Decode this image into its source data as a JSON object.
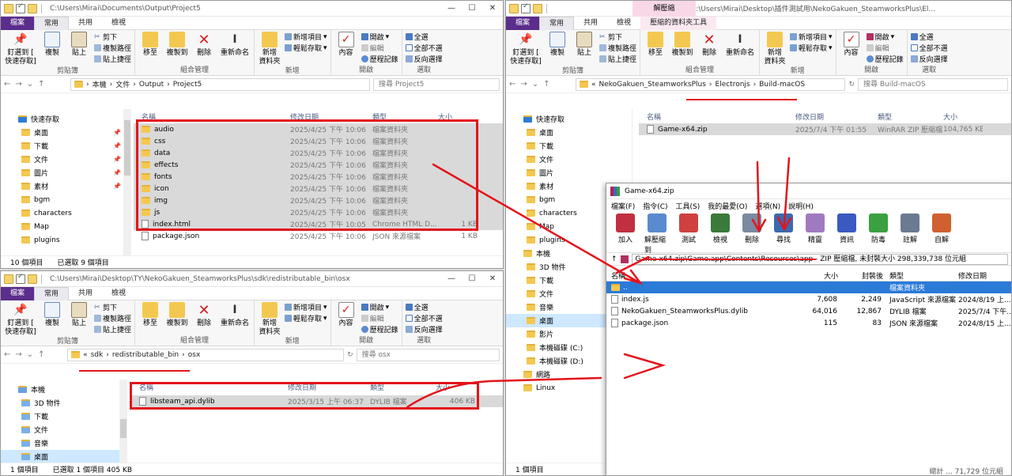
{
  "ribbon_labels": {
    "file": "檔案",
    "home": "常用",
    "share": "共用",
    "view": "檢視",
    "pin": "釘選到 [\n快速存取]",
    "copy": "複製",
    "paste": "貼上",
    "cut": "剪下",
    "copy_path": "複製路徑",
    "paste_shortcut": "貼上捷徑",
    "move_to": "移至",
    "copy_to": "複製到",
    "delete": "刪除",
    "rename": "重新命名",
    "new_folder": "新增\n資料夾",
    "new_item": "新增項目",
    "easy_access": "輕鬆存取",
    "properties": "內容",
    "open": "開啟",
    "edit": "編輯",
    "history": "歷程記錄",
    "select_all": "全選",
    "select_none": "全部不選",
    "invert": "反向選擇",
    "g_clipboard": "剪貼簿",
    "g_organize": "組合管理",
    "g_new": "新增",
    "g_open": "開啟",
    "g_select": "選取",
    "manage_tab": "解壓縮",
    "compressed_tools": "壓縮的資料夾工具"
  },
  "col_headers": {
    "name": "名稱",
    "modified": "修改日期",
    "type": "類型",
    "size": "大小"
  },
  "win1": {
    "title": "C:\\Users\\Mirai\\Documents\\Output\\Project5",
    "path": [
      "本機",
      "文件",
      "Output",
      "Project5"
    ],
    "search": "搜尋 Project5",
    "nav": [
      {
        "label": "快速存取",
        "pinned": false
      },
      {
        "label": "桌面",
        "pinned": true
      },
      {
        "label": "下載",
        "pinned": true
      },
      {
        "label": "文件",
        "pinned": true
      },
      {
        "label": "圖片",
        "pinned": true
      },
      {
        "label": "素材",
        "pinned": true
      },
      {
        "label": "bgm",
        "pinned": false
      },
      {
        "label": "characters",
        "pinned": false
      },
      {
        "label": "Map",
        "pinned": false
      },
      {
        "label": "plugins",
        "pinned": false
      }
    ],
    "files": [
      {
        "name": "audio",
        "date": "2025/4/25 下午 10:06",
        "type": "檔案資料夾",
        "size": ""
      },
      {
        "name": "css",
        "date": "2025/4/25 下午 10:06",
        "type": "檔案資料夾",
        "size": ""
      },
      {
        "name": "data",
        "date": "2025/4/25 下午 10:06",
        "type": "檔案資料夾",
        "size": ""
      },
      {
        "name": "effects",
        "date": "2025/4/25 下午 10:06",
        "type": "檔案資料夾",
        "size": ""
      },
      {
        "name": "fonts",
        "date": "2025/4/25 下午 10:06",
        "type": "檔案資料夾",
        "size": ""
      },
      {
        "name": "icon",
        "date": "2025/4/25 下午 10:06",
        "type": "檔案資料夾",
        "size": ""
      },
      {
        "name": "img",
        "date": "2025/4/25 下午 10:06",
        "type": "檔案資料夾",
        "size": ""
      },
      {
        "name": "js",
        "date": "2025/4/25 下午 10:06",
        "type": "檔案資料夾",
        "size": ""
      },
      {
        "name": "index.html",
        "date": "2025/4/25 下午 10:05",
        "type": "Chrome HTML D...",
        "size": "1 KB"
      },
      {
        "name": "package.json",
        "date": "2025/4/25 下午 10:06",
        "type": "JSON 來源檔案",
        "size": "1 KB"
      }
    ],
    "status_count": "10 個項目",
    "status_sel": "已選取 9 個項目"
  },
  "win2": {
    "title": "C:\\Users\\Mirai\\Desktop\\TY\\NekoGakuen_SteamworksPlus\\sdk\\redistributable_bin\\osx",
    "path": [
      "«",
      "sdk",
      "redistributable_bin",
      "osx"
    ],
    "search": "搜尋 osx",
    "nav": [
      {
        "label": "本機"
      },
      {
        "label": "3D 物件"
      },
      {
        "label": "下載"
      },
      {
        "label": "文件"
      },
      {
        "label": "音樂"
      },
      {
        "label": "桌面"
      }
    ],
    "files": [
      {
        "name": "libsteam_api.dylib",
        "date": "2025/3/15 上午 06:37",
        "type": "DYLIB 檔案",
        "size": "406 KB"
      }
    ],
    "status_count": "1 個項目",
    "status_sel": "已選取 1 個項目  405 KB"
  },
  "win3": {
    "title": "C:\\Users\\Mirai\\Desktop\\插件測試用\\NekoGakuen_SteamworksPlus\\El...",
    "path": [
      "«",
      "NekoGakuen_SteamworksPlus",
      "Electronjs",
      "Build-macOS"
    ],
    "search": "搜尋 Build-macOS",
    "nav": [
      {
        "label": "快速存取"
      },
      {
        "label": "桌面"
      },
      {
        "label": "下載"
      },
      {
        "label": "文件"
      },
      {
        "label": "圖片"
      },
      {
        "label": "素材"
      },
      {
        "label": "bgm"
      },
      {
        "label": "characters"
      },
      {
        "label": "Map"
      },
      {
        "label": "plugins"
      },
      {
        "label": "本機"
      },
      {
        "label": "3D 物件"
      },
      {
        "label": "下載"
      },
      {
        "label": "文件"
      },
      {
        "label": "音樂"
      },
      {
        "label": "桌面"
      },
      {
        "label": "影片"
      },
      {
        "label": "本機磁碟 (C:)"
      },
      {
        "label": "本機磁碟 (D:)"
      },
      {
        "label": "網路"
      },
      {
        "label": "Linux"
      }
    ],
    "files": [
      {
        "name": "Game-x64.zip",
        "date": "2025/7/4 下午 01:55",
        "type": "WinRAR ZIP 壓縮檔",
        "size": "104,765 KB"
      }
    ],
    "status_count": "1 個項目"
  },
  "winrar": {
    "title": "Game-x64.zip",
    "menu": [
      "檔案(F)",
      "指令(C)",
      "工具(S)",
      "我的最愛(O)",
      "選項(N)",
      "說明(H)"
    ],
    "tools": [
      {
        "label": "加入",
        "color": "#c03040"
      },
      {
        "label": "解壓縮到",
        "color": "#5a8ad0"
      },
      {
        "label": "測試",
        "color": "#d04040"
      },
      {
        "label": "檢視",
        "color": "#3a7a3a"
      },
      {
        "label": "刪除",
        "color": "#7a8aa0"
      },
      {
        "label": "尋找",
        "color": "#3a6ab0"
      },
      {
        "label": "精靈",
        "color": "#a07ac0"
      },
      {
        "label": "資訊",
        "color": "#3a5ac0"
      },
      {
        "label": "防毒",
        "color": "#3aa040"
      },
      {
        "label": "註解",
        "color": "#6a7a90"
      },
      {
        "label": "自解",
        "color": "#d06030"
      }
    ],
    "path": "Game-x64.zip\\Game.app\\Contents\\Resources\\app - ZIP 壓縮檔, 未封裝大小 298,339,738 位元組",
    "cols": {
      "name": "名稱",
      "size": "大小",
      "packed": "封裝後",
      "type": "類型",
      "date": "修改日期"
    },
    "files": [
      {
        "name": "..",
        "size": "",
        "packed": "",
        "type": "檔案資料夾",
        "date": ""
      },
      {
        "name": "index.js",
        "size": "7,608",
        "packed": "2,249",
        "type": "JavaScript 來源檔案",
        "date": "2024/8/19 上..."
      },
      {
        "name": "NekoGakuen_SteamworksPlus.dylib",
        "size": "64,016",
        "packed": "12,867",
        "type": "DYLIB 檔案",
        "date": "2025/7/4 下午..."
      },
      {
        "name": "package.json",
        "size": "115",
        "packed": "83",
        "type": "JSON 來源檔案",
        "date": "2024/8/15 上..."
      }
    ],
    "status": "總計 ... 71,729 位元組"
  }
}
